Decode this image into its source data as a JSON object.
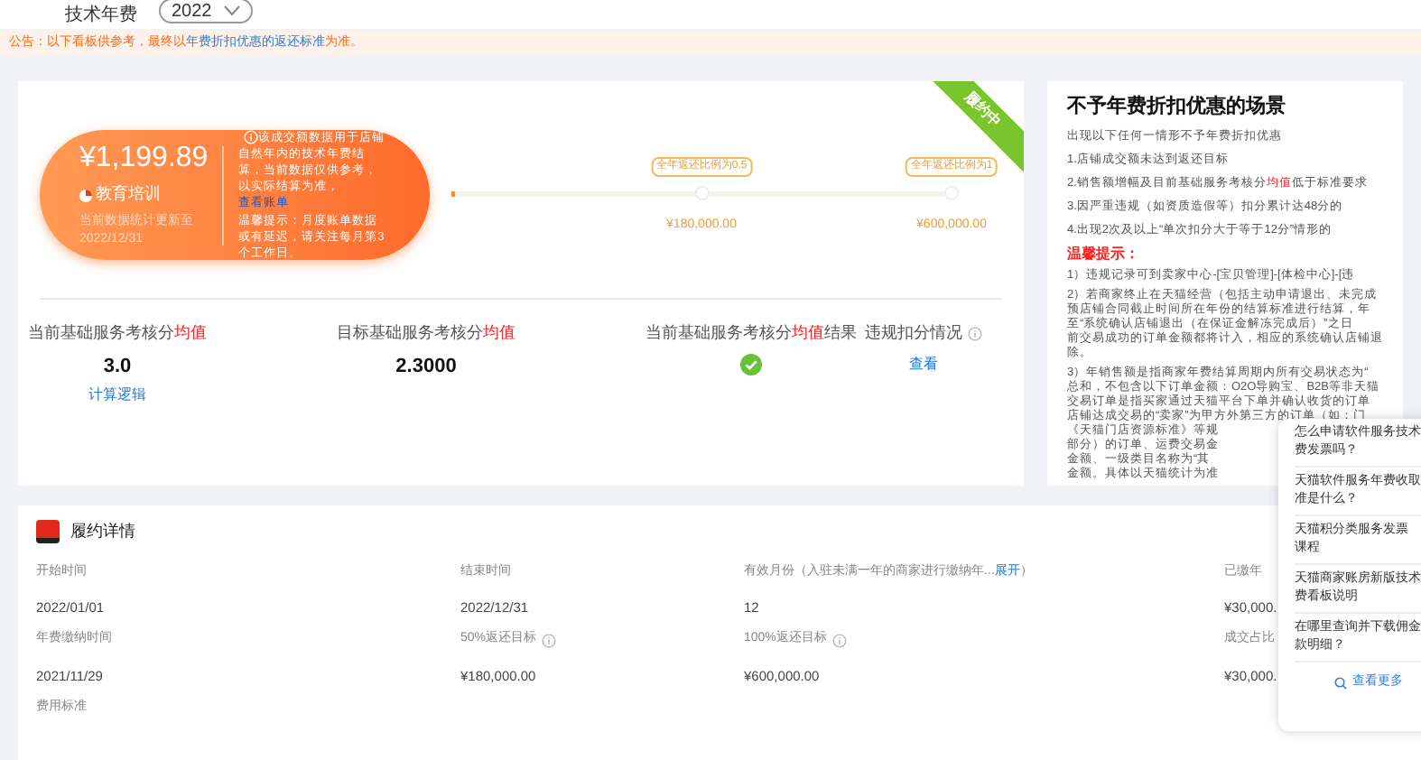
{
  "header": {
    "label": "技术年费",
    "select": "2022"
  },
  "notice": {
    "prefix": "公告：以下看板供参考，最终以",
    "link": "年费折扣优惠的返还标准",
    "suffix": "为准。"
  },
  "summary": {
    "amount": "¥1,199.89",
    "category": "教育培训",
    "updated_label": "当前数据统计更新至",
    "updated_date": "2022/12/31",
    "note_info": true,
    "note": "该成交额数据用于店铺自然年内的技术年费结算，当前数据仅供参考，以实际结算为准，",
    "note_link": "查看账单",
    "tip": "温馨提示：月度账单数据或有延迟，请关注每月第3个工作日。"
  },
  "ribbon": "履约中",
  "progress": {
    "level": 0.004,
    "milestones": [
      {
        "tag": "全年返还比例为0.5",
        "value": "¥180,000.00"
      },
      {
        "tag": "全年返还比例为1",
        "value": "¥600,000.00"
      }
    ]
  },
  "stats": [
    {
      "kind": "number",
      "label": "当前基础服务考核分",
      "highlight": "均值",
      "value": "3.0",
      "link": "计算逻辑"
    },
    {
      "kind": "number",
      "label": "目标基础服务考核分",
      "highlight": "均值",
      "value": "2.3000"
    },
    {
      "kind": "result",
      "label": "当前基础服务考核分",
      "highlight": "均值",
      "suffix": "结果",
      "passed": true
    },
    {
      "kind": "link",
      "label": "违规扣分情况",
      "info": true,
      "link": "查看"
    }
  ],
  "side": {
    "title": "不予年费折扣优惠的场景",
    "intro": "出现以下任何一情形不予年费折扣优惠",
    "conditions": [
      {
        "text": "1.店铺成交额未达到返还目标"
      },
      {
        "text": "2.销售额增幅及目前基础服务考核分",
        "highlight": "均值",
        "suffix": "低于标准要求"
      },
      {
        "text": "3.因严重违规（如资质造假等）扣分累计达48分的"
      },
      {
        "text": "4.出现2次及以上“单次扣分大于等于12分”情形的"
      }
    ],
    "warning": "温馨提示：",
    "rules": [
      [
        "1）违规记录可到卖家中心-[宝贝管理]-[体检中心]-[违"
      ],
      [
        "2）若商家终止在天猫经营（包括主动申请退出、未完成",
        "预店铺合同截止时间所在年份的结算标准进行结算，年",
        "至“系统确认店铺退出（在保证金解冻完成后）”之日",
        "前交易成功的订单金额都将计入，相应的系统确认店铺退",
        "除。"
      ],
      [
        "3）年销售额是指商家年费结算周期内所有交易状态为“",
        "总和，不包含以下订单金额：O2O导购宝、B2B等非天猫",
        "交易订单是指买家通过天猫平台下单并确认收货的订单",
        "店铺达成交易的“卖家”为甲方外第三方的订单（如：门",
        "《天猫门店资源标准》等规",
        "部分）的订单、运费交易金",
        "金额、一级类目名称为“其",
        "金额。具体以天猫统计为准"
      ]
    ]
  },
  "details": {
    "title": "履约详情",
    "rows": [
      [
        {
          "label": "开始时间",
          "value": "2022/01/01"
        },
        {
          "label": "结束时间",
          "value": "2022/12/31"
        },
        {
          "label": "有效月份（入驻未满一年的商家进行缴纳年...",
          "link": "展开",
          "label_end": "）",
          "value": "12"
        },
        {
          "label": "已缴年",
          "value": "¥30,000."
        }
      ],
      [
        {
          "label": "年费缴纳时间",
          "value": "2021/11/29"
        },
        {
          "label": "50%返还目标",
          "info": true,
          "value": "¥180,000.00"
        },
        {
          "label": "100%返还目标",
          "info": true,
          "value": "¥600,000.00"
        },
        {
          "label": "成交占比",
          "value": "¥30,000."
        }
      ],
      [
        {
          "label": "费用标准"
        }
      ]
    ]
  },
  "faq": {
    "items": [
      [
        "怎么申请软件服务技术",
        "费发票吗？"
      ],
      [
        "天猫软件服务年费收取",
        "准是什么？"
      ],
      [
        "天猫积分类服务发票",
        "课程"
      ],
      [
        "天猫商家账房新版技术",
        "费看板说明"
      ],
      [
        "在哪里查询并下载佣金",
        "款明细？"
      ]
    ],
    "more": "查看更多"
  }
}
